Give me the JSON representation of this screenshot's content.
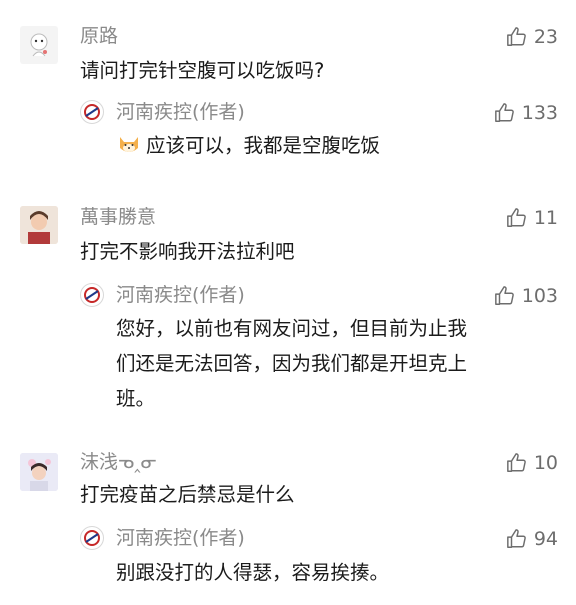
{
  "comments": [
    {
      "user": "原路",
      "text": "请问打完针空腹可以吃饭吗?",
      "likes": "23",
      "reply": {
        "user": "河南疾控(作者)",
        "text": "应该可以，我都是空腹吃饭",
        "likes": "133",
        "emoji": "shiba-dog-emoji"
      }
    },
    {
      "user": "萬事勝意",
      "text": "打完不影响我开法拉利吧",
      "likes": "11",
      "reply": {
        "user": "河南疾控(作者)",
        "line1": "您好，以前也有网友问过，但目前为止我",
        "line2": "们还是无法回答，因为我们都是开坦克上",
        "line3": "班。",
        "likes": "103"
      }
    },
    {
      "user": "沫浅ᓀ‸ᓂ",
      "text": "打完疫苗之后禁忌是什么",
      "likes": "10",
      "reply": {
        "user": "河南疾控(作者)",
        "text": "别跟没打的人得瑟，容易挨揍。",
        "likes": "94"
      }
    }
  ],
  "icons": {
    "like": "thumbs-up-icon",
    "author_avatar": "henan-cdc-logo"
  }
}
